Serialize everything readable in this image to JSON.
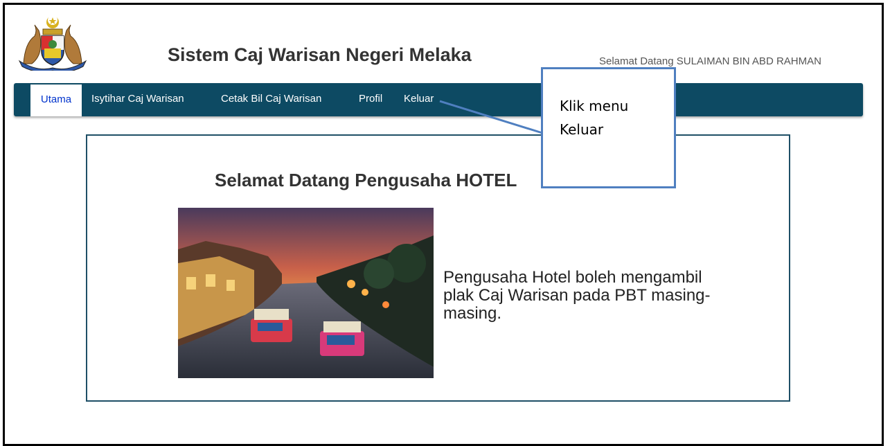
{
  "header": {
    "title": "Sistem Caj Warisan Negeri Melaka",
    "welcome": "Selamat Datang SULAIMAN BIN ABD RAHMAN",
    "logo_icon": "melaka-coat-of-arms-icon"
  },
  "nav": {
    "items": [
      {
        "label": "Utama",
        "active": true
      },
      {
        "label": "Isytihar Caj Warisan",
        "active": false
      },
      {
        "label": "Cetak Bil Caj Warisan",
        "active": false
      },
      {
        "label": "Profil",
        "active": false
      },
      {
        "label": "Keluar",
        "active": false
      }
    ]
  },
  "main": {
    "heading": "Selamat Datang Pengusaha HOTEL",
    "info": "Pengusaha Hotel boleh mengambil plak Caj Warisan pada PBT masing-masing."
  },
  "callout": {
    "line1": "Klik menu",
    "line2": "Keluar"
  },
  "colors": {
    "nav_bg": "#0d4a63",
    "active_text": "#0033cc",
    "callout_border": "#4f7fc0"
  }
}
